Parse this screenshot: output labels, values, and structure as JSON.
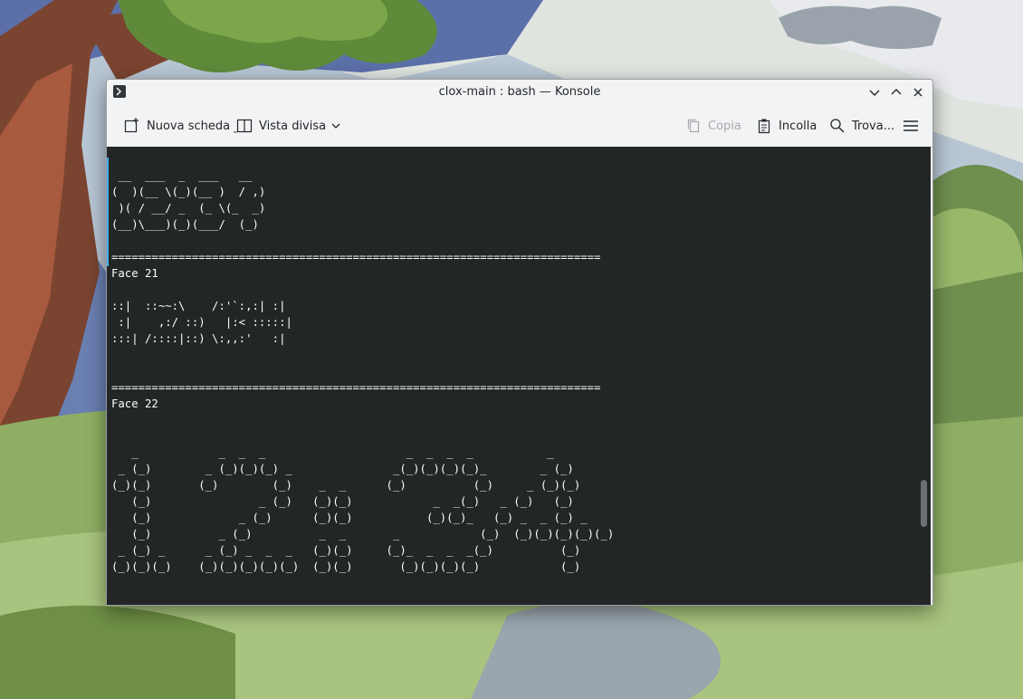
{
  "window": {
    "title": "clox-main : bash — Konsole"
  },
  "toolbar": {
    "new_tab_label": "Nuova scheda",
    "split_view_label": "Vista divisa",
    "copy_label": "Copia",
    "paste_label": "Incolla",
    "find_label": "Trova..."
  },
  "terminal": {
    "content": " __  ___  _  ___   __\n(  )(__ \\(_)(__ )  / ,)\n )( / __/ _  (_ \\(_  _)\n(__)\\___)(_)(___/  (_)\n\n=========================================================================\nFace 21\n\n::|  ::~~:\\    /:'`:,:| :|\n :|    ,:/ ::)   |:< :::::|\n:::| /::::|::) \\:,,:'   :|\n\n\n=========================================================================\nFace 22\n\n\n   _            _  _  _                     _  _  _  _           _\n _ (_)        _ (_)(_)(_) _               _(_)(_)(_)(_)_        _ (_)\n(_)(_)       (_)        (_)    _  _      (_)          (_)     _ (_)(_)\n   (_)                _ (_)   (_)(_)            _  _(_)   _ (_)   (_)\n   (_)             _ (_)      (_)(_)           (_)(_)_   (_) _  _ (_) _\n   (_)          _ (_)          _  _       _            (_)  (_)(_)(_)(_)(_)\n _ (_) _      _ (_) _  _  _   (_)(_)     (_)_  _  _  _(_)          (_)\n(_)(_)(_)    (_)(_)(_)(_)(_)  (_)(_)       (_)(_)(_)(_)            (_)"
  },
  "colors": {
    "terminal_bg": "#232627",
    "terminal_fg": "#fcfcfc",
    "accent": "#3daee9",
    "titlebar_bg": "#f2f3f4"
  }
}
